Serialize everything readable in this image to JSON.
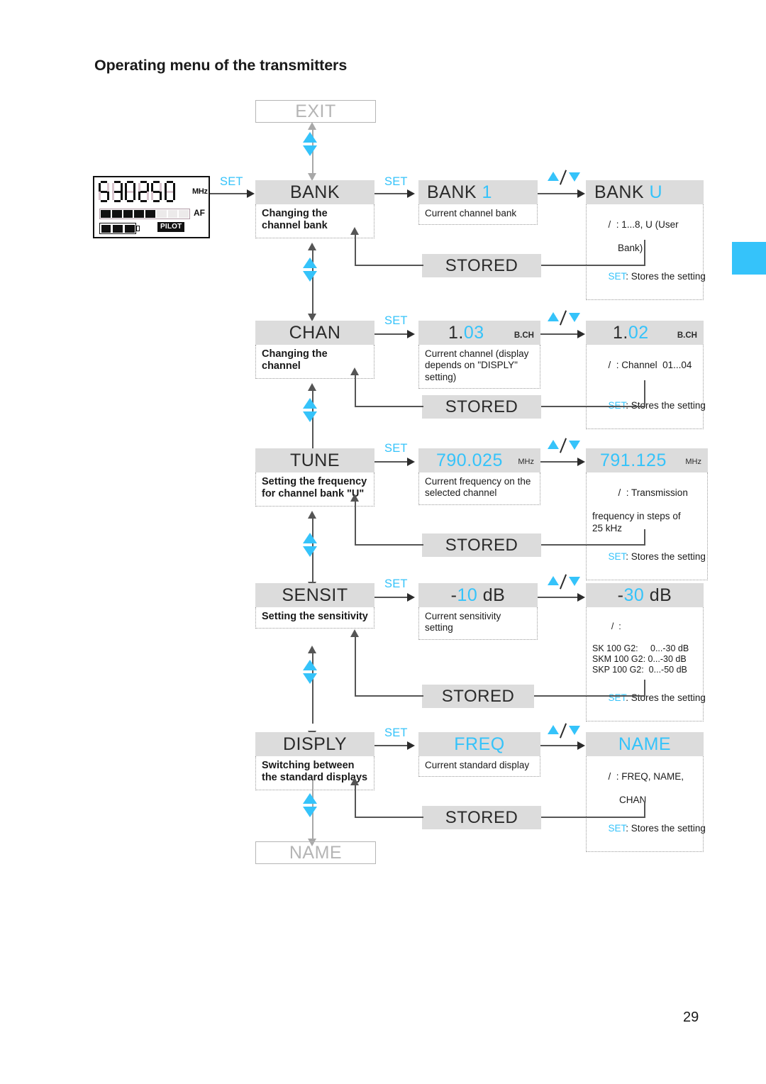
{
  "page": {
    "title": "Operating menu of the transmitters",
    "number": "29",
    "accent_color": "#35c3fa",
    "box_fill": "#dcdcdc"
  },
  "lcd": {
    "frequency": "530250",
    "unit_label": "MHz",
    "af_label": "AF",
    "pilot_label": "PILOT",
    "af_segments_on": 5,
    "af_segments_total": 8,
    "battery_bars": 3
  },
  "exit_box": {
    "label": "EXIT"
  },
  "name_box": {
    "label": "NAME"
  },
  "stored_label": "STORED",
  "set_label": "SET",
  "updown_icon": "up-down-arrows-icon",
  "rows": [
    {
      "id": "bank",
      "menu": {
        "title": "BANK",
        "desc": "Changing the channel bank"
      },
      "current": {
        "title": "BANK",
        "value": "1",
        "suffix": "",
        "desc": "Current channel bank"
      },
      "edit": {
        "title": "BANK",
        "value": "U",
        "suffix": "",
        "range_icon": "/",
        "range_text": ": 1...8, U (User",
        "range_text2": "Bank)",
        "set_tag": "SET",
        "set_text": ": Stores the setting"
      }
    },
    {
      "id": "chan",
      "menu": {
        "title": "CHAN",
        "desc": "Changing the channel"
      },
      "current": {
        "title": "1.",
        "value": "03",
        "suffix": "B.CH",
        "desc": "Current channel (display depends on \"DISPLY\" setting)"
      },
      "edit": {
        "title": "1.",
        "value": "02",
        "suffix": "B.CH",
        "range_icon": "/",
        "range_text": ": Channel  01...04",
        "range_text2": "",
        "set_tag": "SET",
        "set_text": ": Stores the setting"
      }
    },
    {
      "id": "tune",
      "menu": {
        "title": "TUNE",
        "desc": "Setting the frequency for channel bank \"U\""
      },
      "current": {
        "title": "",
        "value": "790.025",
        "suffix": "MHz",
        "desc": "Current frequency on the selected channel"
      },
      "edit": {
        "title": "",
        "value": "791.125",
        "suffix": "MHz",
        "range_icon": "/",
        "range_text": ": Transmission",
        "range_text2": "frequency in steps of",
        "range_text3": "25 kHz",
        "set_tag": "SET",
        "set_text": ": Stores the setting"
      }
    },
    {
      "id": "sensit",
      "menu": {
        "title": "SENSIT",
        "desc": "Setting the sensitivity"
      },
      "current": {
        "title": "-",
        "value": "10",
        "after": " dB",
        "suffix": "",
        "desc": "Current sensitivity setting"
      },
      "edit": {
        "title": "-",
        "value": "30",
        "after": " dB",
        "suffix": "",
        "range_icon": "/",
        "range_text": ":",
        "lines": [
          "SK 100 G2:     0...-30 dB",
          "SKM 100 G2: 0...-30 dB",
          "SKP 100 G2:  0...-50 dB"
        ],
        "set_tag": "SET",
        "set_text": ": Stores the setting"
      }
    },
    {
      "id": "disply",
      "menu": {
        "title": "DISPLY",
        "desc": "Switching between the standard displays"
      },
      "current": {
        "title": "",
        "value": "FREQ",
        "suffix": "",
        "desc": "Current standard display"
      },
      "edit": {
        "title": "",
        "value": "NAME",
        "suffix": "",
        "range_icon": "/",
        "range_text": ": FREQ, NAME,",
        "range_text2": "CHAN",
        "set_tag": "SET",
        "set_text": ": Stores the setting"
      }
    }
  ]
}
